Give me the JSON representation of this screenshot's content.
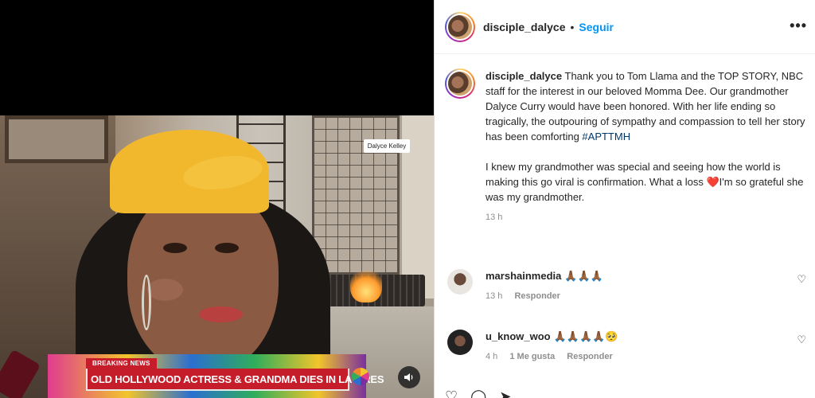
{
  "video": {
    "name_tag": "Dalyce Kelley",
    "breaking_label": "BREAKING NEWS",
    "headline": "OLD HOLLYWOOD ACTRESS & GRANDMA DIES IN LA FIRES",
    "sound_icon": "speaker-icon"
  },
  "post": {
    "username": "disciple_dalyce",
    "separator": "•",
    "follow_label": "Seguir",
    "more_icon": "•••",
    "caption": {
      "username": "disciple_dalyce",
      "paragraph1": "Thank you to Tom Llama and the TOP STORY, NBC staff for the interest in our beloved Momma Dee. Our grandmother Dalyce Curry would have been honored. With her life ending so tragically, the outpouring of sympathy and compassion to tell her story has been comforting",
      "hashtag": "#APTTMH",
      "paragraph2a": "I knew my grandmother was special and seeing how the world is making this go viral is confirmation. What a loss",
      "heart": "❤️",
      "paragraph2b": "I'm so grateful she was my grandmother.",
      "time": "13 h"
    },
    "comments": [
      {
        "username": "marshainmedia",
        "text": "🙏🏾🙏🏾🙏🏾",
        "time": "13 h",
        "likes": "",
        "reply": "Responder"
      },
      {
        "username": "u_know_woo",
        "text": "🙏🏾🙏🏾🙏🏾🙏🏾🥺",
        "time": "4 h",
        "likes": "1 Me gusta",
        "reply": "Responder"
      }
    ],
    "like_icon": "♡"
  },
  "colors": {
    "accent_blue": "#0095f6",
    "breaking_red": "#c61d2b",
    "muted_text": "#8e8e8e"
  }
}
